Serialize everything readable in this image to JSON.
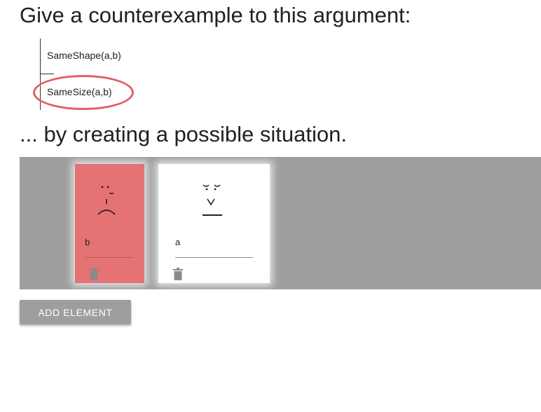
{
  "instructions": {
    "heading_1": "Give a counterexample to this argument:",
    "heading_2": "... by creating a possible situation."
  },
  "argument": {
    "premises": [
      "SameShape(a,b)"
    ],
    "conclusion": "SameSize(a,b)",
    "conclusion_highlighted": true
  },
  "world": {
    "background_color": "#9e9e9e",
    "elements": [
      {
        "name": "b",
        "color": "#e57373",
        "face": "sad-face-icon"
      },
      {
        "name": "a",
        "color": "#ffffff",
        "face": "neutral-face-icon"
      }
    ]
  },
  "controls": {
    "add_element_label": "ADD ELEMENT"
  }
}
